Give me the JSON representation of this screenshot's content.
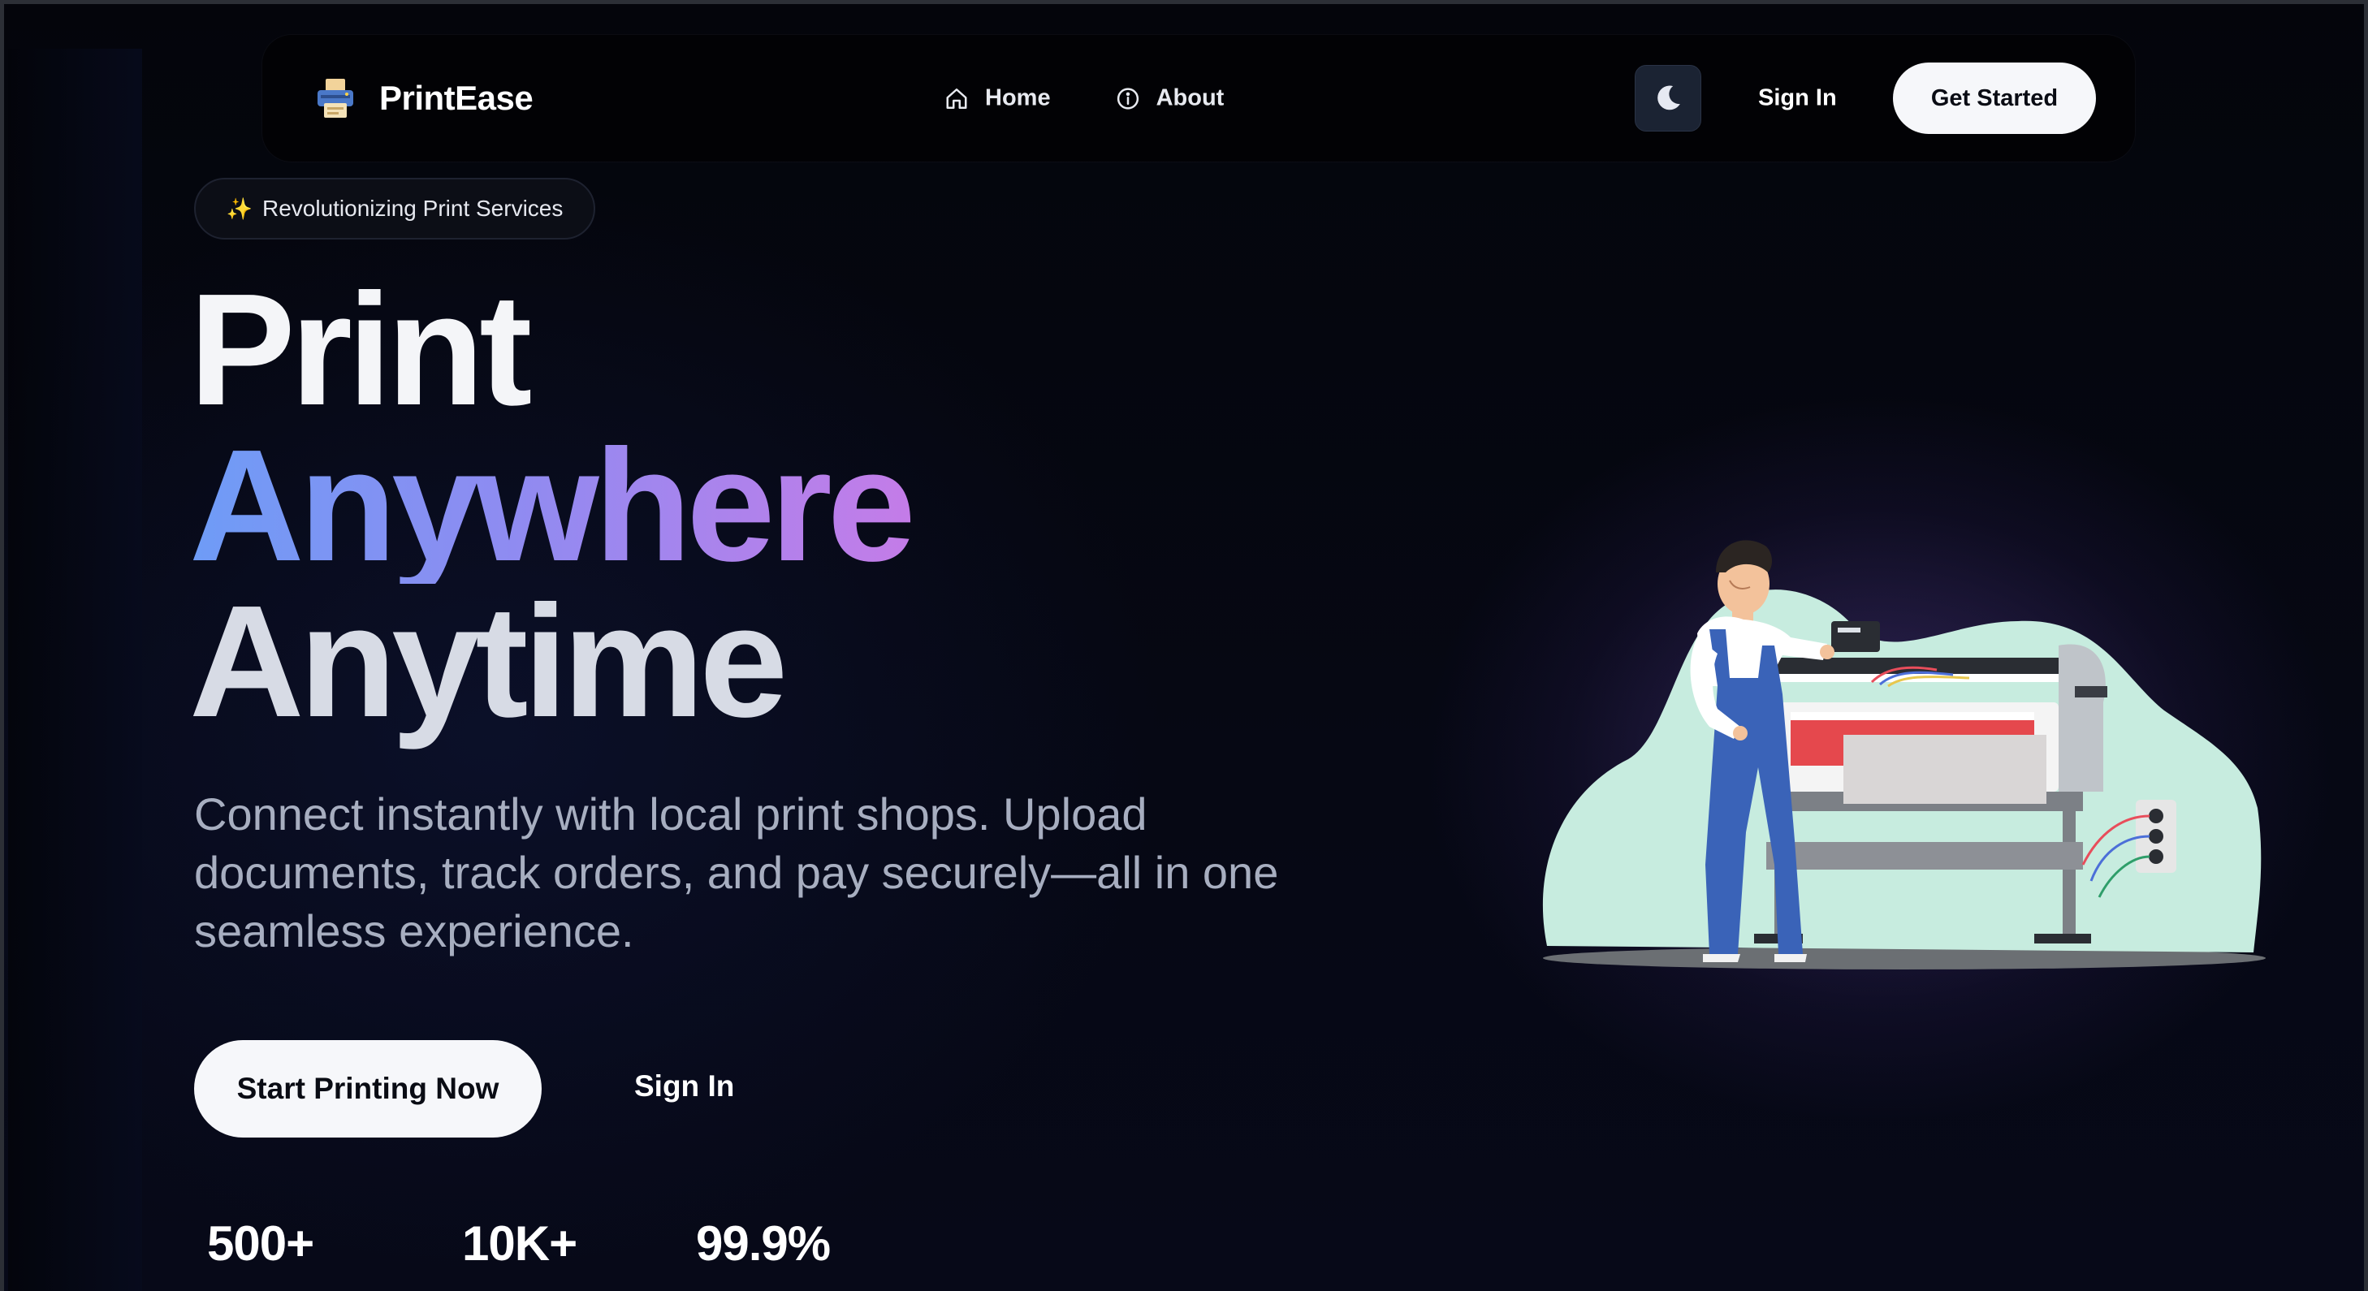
{
  "brand": {
    "name": "PrintEase",
    "logo_icon": "printer-icon"
  },
  "nav": {
    "links": [
      {
        "label": "Home",
        "icon": "home-icon"
      },
      {
        "label": "About",
        "icon": "info-icon"
      }
    ],
    "theme_toggle_icon": "moon-icon",
    "signin_label": "Sign In",
    "cta_label": "Get Started"
  },
  "hero": {
    "badge_icon": "sparkles-icon",
    "badge_label": "Revolutionizing Print Services",
    "headline_line1": "Print",
    "headline_line2": "Anywhere",
    "headline_line3": "Anytime",
    "subtitle": "Connect instantly with local print shops. Upload documents, track orders, and pay securely—all in one seamless experience.",
    "primary_cta": "Start Printing Now",
    "secondary_cta": "Sign In",
    "stats": [
      "500+",
      "10K+",
      "99.9%"
    ],
    "illustration": "printer-operator-illustration"
  },
  "colors": {
    "background": "#05060d",
    "gradient_start": "#6e9cf6",
    "gradient_end": "#c47ce8",
    "button_bg": "#f6f7fa"
  }
}
